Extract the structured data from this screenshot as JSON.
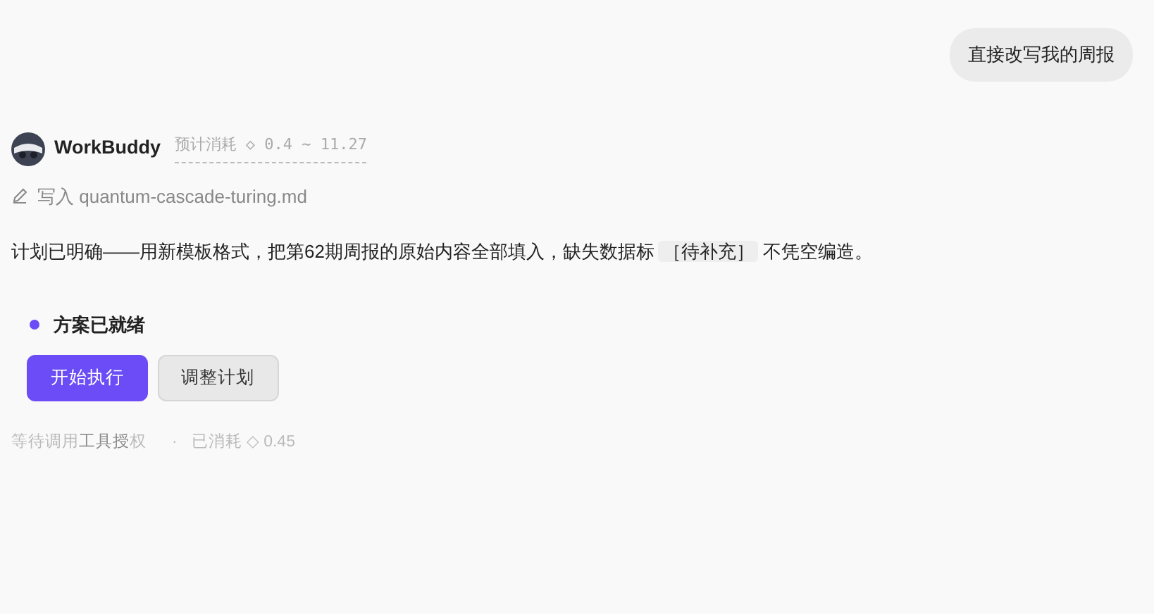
{
  "user_message": "直接改写我的周报",
  "assistant": {
    "name": "WorkBuddy",
    "cost_estimate": "预计消耗 ◇ 0.4 ~ 11.27"
  },
  "action": {
    "verb": "写入",
    "file": "quantum-cascade-turing.md"
  },
  "message": [
    {
      "kind": "text",
      "text": "计划已明确——用新模板格式，把第62期周报的原始内容全部填入，缺失数据标"
    },
    {
      "kind": "code",
      "text": "［待补充］"
    },
    {
      "kind": "text",
      "text": "不凭空编造。"
    }
  ],
  "plan_status": {
    "label": "方案已就绪",
    "color": "#6b4cf6"
  },
  "buttons": [
    {
      "label": "开始执行",
      "kind": "primary"
    },
    {
      "label": "调整计划",
      "kind": "secondary"
    }
  ],
  "footer": {
    "status": "等待调用**工具授**权",
    "separator": "·",
    "spent": "已消耗 ◇ 0.45"
  }
}
